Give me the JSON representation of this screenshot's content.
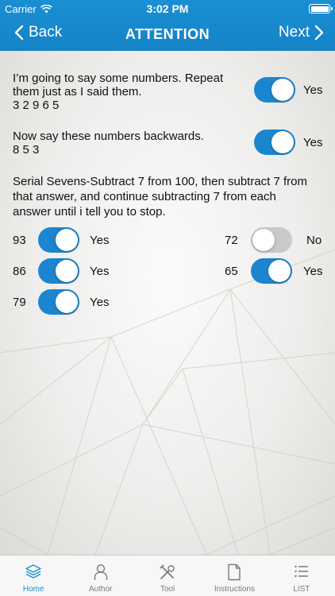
{
  "status": {
    "carrier": "Carrier",
    "time": "3:02 PM"
  },
  "nav": {
    "back_label": "Back",
    "title": "ATTENTION",
    "next_label": "Next"
  },
  "q1": {
    "line1": "I’m going to say some numbers.  Repeat",
    "line2": "them just as I said them.",
    "line3": "3 2 9 6 5",
    "toggle_label": "Yes",
    "toggle_on": true
  },
  "q2": {
    "line1": "Now say these numbers backwards.",
    "line2": "8 5 3",
    "toggle_label": "Yes",
    "toggle_on": true
  },
  "q3": {
    "line1": "Serial Sevens-Subtract 7 from 100, then subtract 7 from",
    "line2": "that answer, and continue subtracting 7 from each",
    "line3": "answer until i tell you to stop."
  },
  "serial": [
    {
      "number": "93",
      "label": "Yes",
      "on": true
    },
    {
      "number": "72",
      "label": "No",
      "on": false
    },
    {
      "number": "86",
      "label": "Yes",
      "on": true
    },
    {
      "number": "65",
      "label": "Yes",
      "on": true
    },
    {
      "number": "79",
      "label": "Yes",
      "on": true
    }
  ],
  "tabs": [
    {
      "label": "Home",
      "icon": "layers-icon",
      "active": true
    },
    {
      "label": "Author",
      "icon": "person-icon",
      "active": false
    },
    {
      "label": "Tool",
      "icon": "tools-icon",
      "active": false
    },
    {
      "label": "Instructions",
      "icon": "document-icon",
      "active": false
    },
    {
      "label": "LIST",
      "icon": "list-icon",
      "active": false
    }
  ],
  "colors": {
    "accent": "#1a8fd3",
    "toggle_on": "#1b86cf",
    "toggle_off": "#c9c9c9"
  }
}
